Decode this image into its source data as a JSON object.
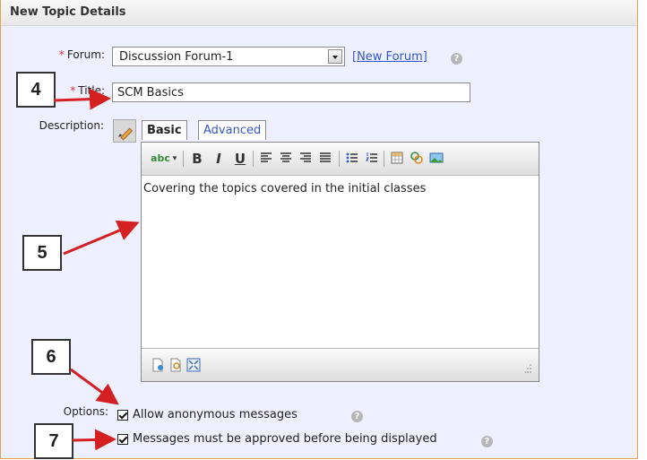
{
  "header": {
    "title": "New Topic Details"
  },
  "form": {
    "forum": {
      "label": "Forum:",
      "value": "Discussion Forum-1",
      "new_link": "[New Forum]"
    },
    "title": {
      "label": "Title:",
      "value": "SCM Basics"
    },
    "description": {
      "label": "Description:",
      "tabs": [
        "Basic",
        "Advanced"
      ],
      "content": "Covering the topics covered in the initial classes"
    },
    "options": {
      "label": "Options:",
      "items": [
        {
          "label": "Allow anonymous messages",
          "checked": true
        },
        {
          "label": "Messages must be approved before being displayed",
          "checked": true
        }
      ]
    }
  },
  "toolbar": {
    "icons": [
      "spellcheck-icon",
      "bold-icon",
      "italic-icon",
      "underline-icon",
      "align-left-icon",
      "align-center-icon",
      "align-right-icon",
      "justify-icon",
      "bullet-list-icon",
      "numbered-list-icon",
      "table-icon",
      "link-icon",
      "image-icon"
    ],
    "bold": "B",
    "italic": "I",
    "underline": "U"
  },
  "callouts": [
    "4",
    "5",
    "6",
    "7"
  ],
  "colors": {
    "arrow": "#d42020",
    "required": "#e03030",
    "link": "#3355cc",
    "panel_bg": "#eef0ff",
    "border": "#e8a050"
  }
}
